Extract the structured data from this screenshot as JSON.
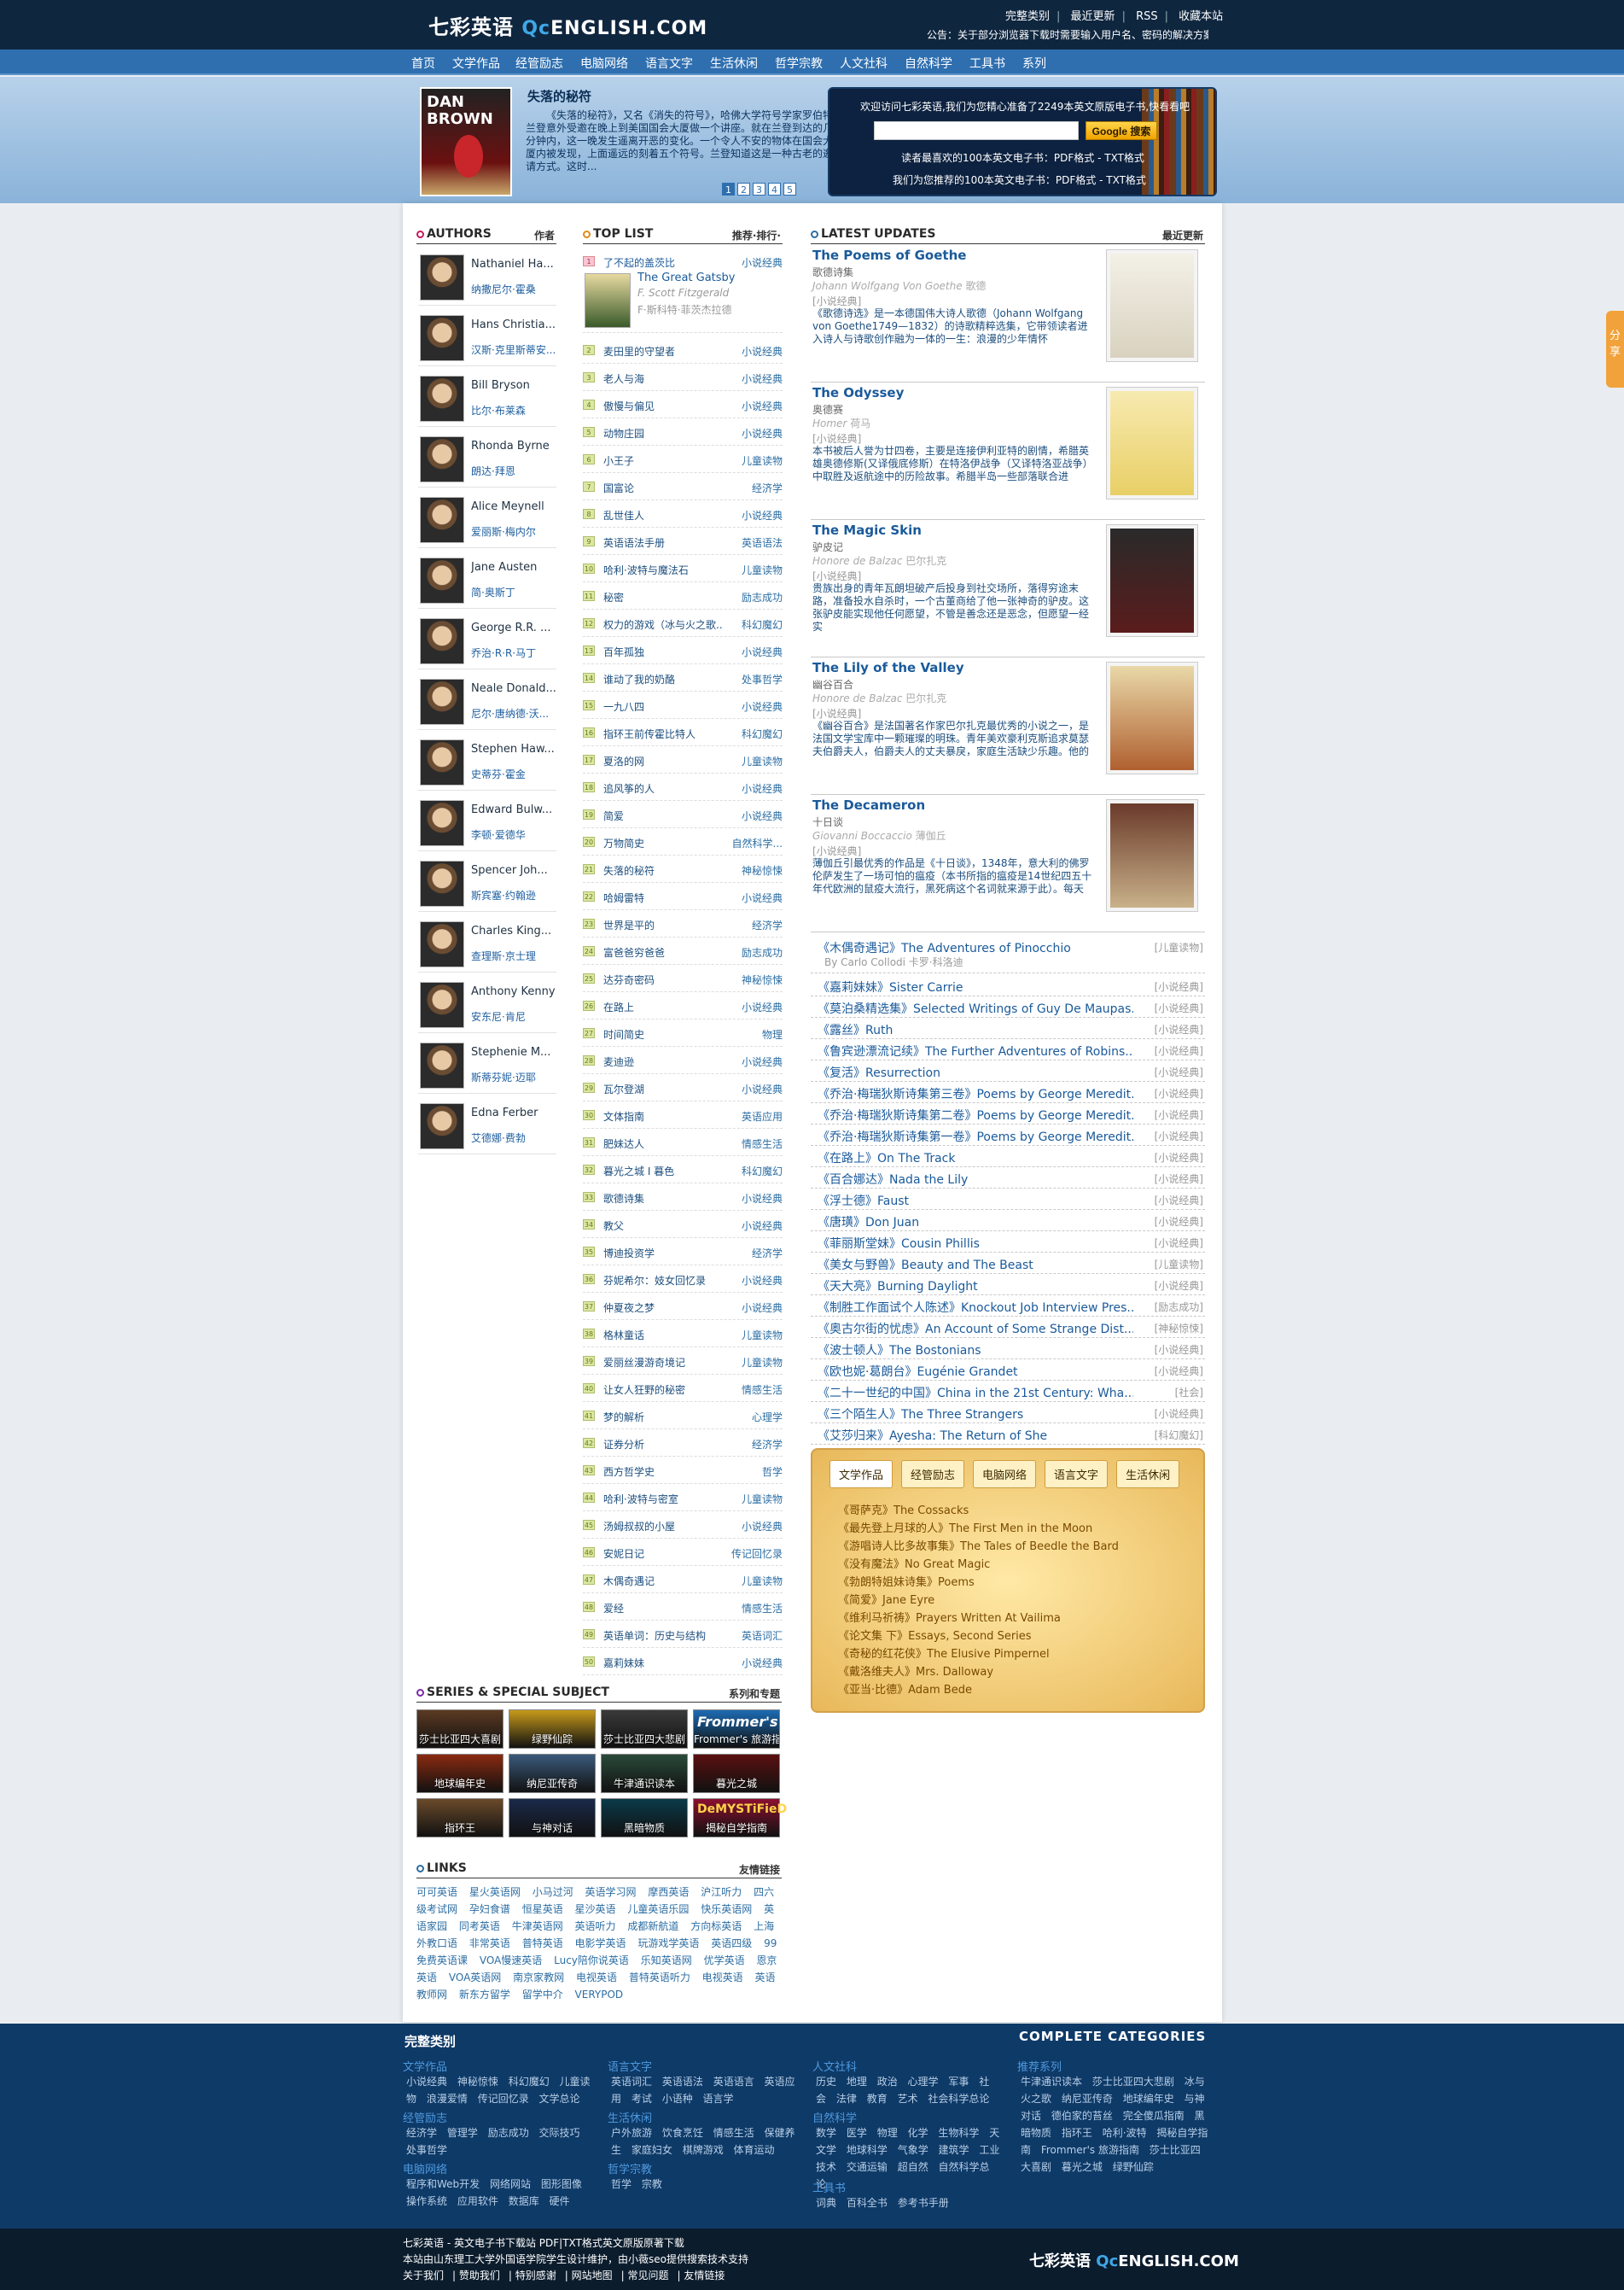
{
  "header": {
    "logo_cn": "七彩英语",
    "logo_qc": "Qc",
    "logo_en": "ENGLISH.COM",
    "top_links": [
      "完整类别",
      "最近更新",
      "RSS",
      "收藏本站"
    ],
    "notice": "公告：关于部分浏览器下载时需要输入用户名、密码的解决方案"
  },
  "nav": [
    "首页",
    "文学作品",
    "经管励志",
    "电脑网络",
    "语言文字",
    "生活休闲",
    "哲学宗教",
    "人文社科",
    "自然科学",
    "工具书",
    "系列"
  ],
  "banner": {
    "cover_text": "DAN BROWN",
    "title": "失落的秘符",
    "desc": "《失落的秘符》，又名《消失的符号》，哈佛大学符号学家罗伯特·兰登意外受邀在晚上到美国国会大厦做一个讲座。就在兰登到达的几分钟内，这一晚发生遥离开恶的变化。一个令人不安的物体在国会大厦内被发现，上面遥远的刻着五个符号。兰登知道这是一种古老的邀请方式。这时...",
    "pages": [
      "1",
      "2",
      "3",
      "4",
      "5"
    ],
    "welcome": "欢迎访问七彩英语,我们为您精心准备了2249本英文原版电子书,快看看吧",
    "search_placeholder": "",
    "search_button": "Google 搜索",
    "link1": "读者最喜欢的100本英文电子书：PDF格式 - TXT格式",
    "link2": "我们为您推荐的100本英文电子书：PDF格式 - TXT格式"
  },
  "authors": {
    "title": "AUTHORS",
    "right": "作者",
    "items": [
      {
        "en": "Nathaniel Ha...",
        "cn": "纳撒尼尔·霍桑"
      },
      {
        "en": "Hans Christia...",
        "cn": "汉斯·克里斯蒂安..."
      },
      {
        "en": "Bill Bryson",
        "cn": "比尔·布莱森"
      },
      {
        "en": "Rhonda Byrne",
        "cn": "朗达·拜恩"
      },
      {
        "en": "Alice Meynell",
        "cn": "爱丽斯·梅内尔"
      },
      {
        "en": "Jane Austen",
        "cn": "简·奥斯丁"
      },
      {
        "en": "George R.R. ...",
        "cn": "乔治·R·R·马丁"
      },
      {
        "en": "Neale Donald...",
        "cn": "尼尔·唐纳德·沃..."
      },
      {
        "en": "Stephen Haw...",
        "cn": "史蒂芬·霍金"
      },
      {
        "en": "Edward Bulw...",
        "cn": "李顿·爱德华"
      },
      {
        "en": "Spencer Joh...",
        "cn": "斯宾塞·约翰逊"
      },
      {
        "en": "Charles King...",
        "cn": "查理斯·京士理"
      },
      {
        "en": "Anthony Kenny",
        "cn": "安东尼·肯尼"
      },
      {
        "en": "Stephenie M...",
        "cn": "斯蒂芬妮·迈耶"
      },
      {
        "en": "Edna Ferber",
        "cn": "艾德娜·费勃"
      }
    ]
  },
  "toplist": {
    "title": "TOP LIST",
    "right": "推荐·排行·",
    "first": {
      "name": "了不起的盖茨比",
      "cat": "小说经典",
      "en": "The Great Gatsby",
      "author": "F. Scott Fitzgerald",
      "author_cn": "F·斯科特·菲茨杰拉德"
    },
    "items": [
      {
        "n": "2",
        "name": "麦田里的守望者",
        "cat": "小说经典"
      },
      {
        "n": "3",
        "name": "老人与海",
        "cat": "小说经典"
      },
      {
        "n": "4",
        "name": "傲慢与偏见",
        "cat": "小说经典"
      },
      {
        "n": "5",
        "name": "动物庄园",
        "cat": "小说经典"
      },
      {
        "n": "6",
        "name": "小王子",
        "cat": "儿童读物"
      },
      {
        "n": "7",
        "name": "国富论",
        "cat": "经济学"
      },
      {
        "n": "8",
        "name": "乱世佳人",
        "cat": "小说经典"
      },
      {
        "n": "9",
        "name": "英语语法手册",
        "cat": "英语语法"
      },
      {
        "n": "10",
        "name": "哈利·波特与魔法石",
        "cat": "儿童读物"
      },
      {
        "n": "11",
        "name": "秘密",
        "cat": "励志成功"
      },
      {
        "n": "12",
        "name": "权力的游戏（冰与火之歌...",
        "cat": "科幻魔幻"
      },
      {
        "n": "13",
        "name": "百年孤独",
        "cat": "小说经典"
      },
      {
        "n": "14",
        "name": "谁动了我的奶酪",
        "cat": "处事哲学"
      },
      {
        "n": "15",
        "name": "一九八四",
        "cat": "小说经典"
      },
      {
        "n": "16",
        "name": "指环王前传霍比特人",
        "cat": "科幻魔幻"
      },
      {
        "n": "17",
        "name": "夏洛的网",
        "cat": "儿童读物"
      },
      {
        "n": "18",
        "name": "追风筝的人",
        "cat": "小说经典"
      },
      {
        "n": "19",
        "name": "简爱",
        "cat": "小说经典"
      },
      {
        "n": "20",
        "name": "万物简史",
        "cat": "自然科学..."
      },
      {
        "n": "21",
        "name": "失落的秘符",
        "cat": "神秘惊悚"
      },
      {
        "n": "22",
        "name": "哈姆雷特",
        "cat": "小说经典"
      },
      {
        "n": "23",
        "name": "世界是平的",
        "cat": "经济学"
      },
      {
        "n": "24",
        "name": "富爸爸穷爸爸",
        "cat": "励志成功"
      },
      {
        "n": "25",
        "name": "达芬奇密码",
        "cat": "神秘惊悚"
      },
      {
        "n": "26",
        "name": "在路上",
        "cat": "小说经典"
      },
      {
        "n": "27",
        "name": "时间简史",
        "cat": "物理"
      },
      {
        "n": "28",
        "name": "麦迪逊",
        "cat": "小说经典"
      },
      {
        "n": "29",
        "name": "瓦尔登湖",
        "cat": "小说经典"
      },
      {
        "n": "30",
        "name": "文体指南",
        "cat": "英语应用"
      },
      {
        "n": "31",
        "name": "肥妹达人",
        "cat": "情感生活"
      },
      {
        "n": "32",
        "name": "暮光之城 I 暮色",
        "cat": "科幻魔幻"
      },
      {
        "n": "33",
        "name": "歌德诗集",
        "cat": "小说经典"
      },
      {
        "n": "34",
        "name": "教父",
        "cat": "小说经典"
      },
      {
        "n": "35",
        "name": "博迪投资学",
        "cat": "经济学"
      },
      {
        "n": "36",
        "name": "芬妮希尔：妓女回忆录",
        "cat": "小说经典"
      },
      {
        "n": "37",
        "name": "仲夏夜之梦",
        "cat": "小说经典"
      },
      {
        "n": "38",
        "name": "格林童话",
        "cat": "儿童读物"
      },
      {
        "n": "39",
        "name": "爱丽丝漫游奇境记",
        "cat": "儿童读物"
      },
      {
        "n": "40",
        "name": "让女人狂野的秘密",
        "cat": "情感生活"
      },
      {
        "n": "41",
        "name": "梦的解析",
        "cat": "心理学"
      },
      {
        "n": "42",
        "name": "证券分析",
        "cat": "经济学"
      },
      {
        "n": "43",
        "name": "西方哲学史",
        "cat": "哲学"
      },
      {
        "n": "44",
        "name": "哈利·波特与密室",
        "cat": "儿童读物"
      },
      {
        "n": "45",
        "name": "汤姆叔叔的小屋",
        "cat": "小说经典"
      },
      {
        "n": "46",
        "name": "安妮日记",
        "cat": "传记回忆录"
      },
      {
        "n": "47",
        "name": "木偶奇遇记",
        "cat": "儿童读物"
      },
      {
        "n": "48",
        "name": "爱经",
        "cat": "情感生活"
      },
      {
        "n": "49",
        "name": "英语单词：历史与结构",
        "cat": "英语词汇"
      },
      {
        "n": "50",
        "name": "嘉莉妹妹",
        "cat": "小说经典"
      }
    ]
  },
  "latest": {
    "title": "LATEST UPDATES",
    "right": "最近更新",
    "featured": [
      {
        "title": "The Poems of Goethe",
        "cn": "歌德诗集",
        "author": "Johann Wolfgang Von Goethe",
        "author_cn": "歌德",
        "cat": "[小说经典]",
        "desc": "《歌德诗选》是一本德国伟大诗人歌德（Johann Wolfgang von Goethe1749—1832）的诗歌精粹选集，它带领读者进入诗人与诗歌创作融为一体的一生：浪漫的少年情怀"
      },
      {
        "title": "The Odyssey",
        "cn": "奥德赛",
        "author": "Homer",
        "author_cn": "荷马",
        "cat": "[小说经典]",
        "desc": "本书被后人誉为廿四卷，主要是连接伊利亚特的剧情，希腊英雄奥德修斯(又译俄底修斯）在特洛伊战争（又译特洛亚战争）中取胜及返航途中的历险故事。希腊半岛一些部落联合进"
      },
      {
        "title": "The Magic Skin",
        "cn": "驴皮记",
        "author": "Honore de Balzac",
        "author_cn": "巴尔扎克",
        "cat": "[小说经典]",
        "desc": "贵族出身的青年瓦朗坦破产后投身到社交场所，落得穷途末路，准备投水自杀时，一个古董商给了他一张神奇的驴皮。这张驴皮能实现他任何愿望，不管是善念还是恶念，但愿望一经实"
      },
      {
        "title": "The Lily of the Valley",
        "cn": "幽谷百合",
        "author": "Honore de Balzac",
        "author_cn": "巴尔扎克",
        "cat": "[小说经典]",
        "desc": "《幽谷百合》是法国著名作家巴尔扎克最优秀的小说之一，是法国文学宝库中一颗璀璨的明珠。青年美欢豪利克斯追求莫瑟夫伯爵夫人，伯爵夫人的丈夫暴戾，家庭生活缺少乐趣。他的"
      },
      {
        "title": "The Decameron",
        "cn": "十日谈",
        "author": "Giovanni Boccaccio",
        "author_cn": "薄伽丘",
        "cat": "[小说经典]",
        "desc": "薄伽丘引最优秀的作品是《十日谈》，1348年，意大利的佛罗伦萨发生了一场可怕的瘟疫（本书所指的瘟疫是14世纪四五十年代欧洲的鼠疫大流行，黑死病这个名词就来源于此）。每天"
      }
    ],
    "pinocchio": {
      "text": "《木偶奇遇记》The Adventures of Pinocchio",
      "cat": "[儿童读物]",
      "author": "By Carlo Collodi 卡罗·科洛迪"
    },
    "list": [
      {
        "text": "《嘉莉妹妹》Sister Carrie",
        "cat": "[小说经典]"
      },
      {
        "text": "《莫泊桑精选集》Selected Writings of Guy De Maupas...",
        "cat": "[小说经典]"
      },
      {
        "text": "《露丝》Ruth",
        "cat": "[小说经典]"
      },
      {
        "text": "《鲁宾逊漂流记续》The Further Adventures of Robins...",
        "cat": "[小说经典]"
      },
      {
        "text": "《复活》Resurrection",
        "cat": "[小说经典]"
      },
      {
        "text": "《乔治·梅瑞狄斯诗集第三卷》Poems by George Meredit...",
        "cat": "[小说经典]"
      },
      {
        "text": "《乔治·梅瑞狄斯诗集第二卷》Poems by George Meredit...",
        "cat": "[小说经典]"
      },
      {
        "text": "《乔治·梅瑞狄斯诗集第一卷》Poems by George Meredit...",
        "cat": "[小说经典]"
      },
      {
        "text": "《在路上》On The Track",
        "cat": "[小说经典]"
      },
      {
        "text": "《百合娜达》Nada the Lily",
        "cat": "[小说经典]"
      },
      {
        "text": "《浮士德》Faust",
        "cat": "[小说经典]"
      },
      {
        "text": "《唐璜》Don Juan",
        "cat": "[小说经典]"
      },
      {
        "text": "《菲丽斯堂妹》Cousin Phillis",
        "cat": "[小说经典]"
      },
      {
        "text": "《美女与野兽》Beauty and The Beast",
        "cat": "[儿童读物]"
      },
      {
        "text": "《天大亮》Burning Daylight",
        "cat": "[小说经典]"
      },
      {
        "text": "《制胜工作面试个人陈述》Knockout Job Interview Pres...",
        "cat": "[励志成功]"
      },
      {
        "text": "《奥古尔街的忧虑》An Account of Some Strange Dist...",
        "cat": "[神秘惊悚]"
      },
      {
        "text": "《波士顿人》The Bostonians",
        "cat": "[小说经典]"
      },
      {
        "text": "《欧也妮·葛朗台》Eugénie Grandet",
        "cat": "[小说经典]"
      },
      {
        "text": "《二十一世纪的中国》China in the 21st Century: Wha...",
        "cat": "[社会]"
      },
      {
        "text": "《三个陌生人》The Three Strangers",
        "cat": "[小说经典]"
      },
      {
        "text": "《艾莎归来》Ayesha: The Return of She",
        "cat": "[科幻魔幻]"
      }
    ]
  },
  "yellowbox": {
    "tabs": [
      "文学作品",
      "经管励志",
      "电脑网络",
      "语言文字",
      "生活休闲"
    ],
    "items": [
      "《哥萨克》The Cossacks",
      "《最先登上月球的人》The First Men in the Moon",
      "《游唱诗人比多故事集》The Tales of Beedle the Bard",
      "《没有魔法》No Great Magic",
      "《勃朗特姐妹诗集》Poems",
      "《简爱》Jane Eyre",
      "《维利马祈祷》Prayers Written At Vailima",
      "《论文集 下》Essays, Second Series",
      "《奇秘的红花侠》The Elusive Pimpernel",
      "《戴洛维夫人》Mrs. Dalloway",
      "《亚当·比德》Adam Bede"
    ]
  },
  "series": {
    "title": "SERIES & SPECIAL SUBJECT",
    "right": "系列和专题",
    "tiles": [
      {
        "label": "莎士比亚四大喜剧",
        "color": "#5b3a22"
      },
      {
        "label": "绿野仙踪",
        "color": "#c79a1a"
      },
      {
        "label": "莎士比亚四大悲剧",
        "color": "#3a3a3a"
      },
      {
        "label": "Frommer's 旅游指",
        "color": "#1c6bb3"
      },
      {
        "label": "地球编年史",
        "color": "#8a2a10"
      },
      {
        "label": "纳尼亚传奇",
        "color": "#3a5a7a"
      },
      {
        "label": "牛津通识读本",
        "color": "#2a4a3a"
      },
      {
        "label": "暮光之城",
        "color": "#5a1010"
      },
      {
        "label": "指环王",
        "color": "#6a4a2a"
      },
      {
        "label": "与神对话",
        "color": "#1a2a4a"
      },
      {
        "label": "黑暗物质",
        "color": "#0a3a4a"
      },
      {
        "label": "揭秘自学指南",
        "color": "#8a1030"
      }
    ],
    "tile_texts": [
      "Frommer's",
      "DeMYSTiFieD"
    ]
  },
  "links": {
    "title": "LINKS",
    "right": "友情链接",
    "items": [
      "可可英语",
      "星火英语网",
      "小马过河",
      "英语学习网",
      "摩西英语",
      "沪江听力",
      "四六级考试网",
      "孕妇食谱",
      "恒星英语",
      "星沙英语",
      "儿童英语乐园",
      "快乐英语网",
      "英语家园",
      "同考英语",
      "牛津英语网",
      "英语听力",
      "成都新航道",
      "方向标英语",
      "上海外教口语",
      "非常英语",
      "普特英语",
      "电影学英语",
      "玩游戏学英语",
      "英语四级",
      "99免费英语课",
      "VOA慢速英语",
      "Lucy陪你说英语",
      "乐知英语网",
      "优学英语",
      "恩京英语",
      "VOA英语网",
      "南京家教网",
      "电视英语",
      "普特英语听力",
      "电视英语",
      "英语教师网",
      "新东方留学",
      "留学中介",
      "VERYPOD"
    ]
  },
  "footer": {
    "cap_cn": "完整类别",
    "cap_en": "COMPLETE CATEGORIES",
    "cols": [
      {
        "head": "文学作品",
        "items": [
          "小说经典",
          "神秘惊悚",
          "科幻魔幻",
          "儿童读物",
          "浪漫爱情",
          "传记回忆录",
          "文学总论"
        ]
      },
      {
        "head": "经管励志",
        "items": [
          "经济学",
          "管理学",
          "励志成功",
          "交际技巧",
          "处事哲学"
        ]
      },
      {
        "head": "电脑网络",
        "items": [
          "程序和Web开发",
          "网络网站",
          "图形图像",
          "操作系统",
          "应用软件",
          "数据库",
          "硬件"
        ]
      },
      {
        "head": "语言文字",
        "items": [
          "英语词汇",
          "英语语法",
          "英语语言",
          "英语应用",
          "考试",
          "小语种",
          "语言学"
        ]
      },
      {
        "head": "生活休闲",
        "items": [
          "户外旅游",
          "饮食烹饪",
          "情感生活",
          "保健养生",
          "家庭妇女",
          "棋牌游戏",
          "体育运动"
        ]
      },
      {
        "head": "哲学宗教",
        "items": [
          "哲学",
          "宗教"
        ]
      },
      {
        "head": "人文社科",
        "items": [
          "历史",
          "地理",
          "政治",
          "心理学",
          "军事",
          "社会",
          "法律",
          "教育",
          "艺术",
          "社会科学总论"
        ]
      },
      {
        "head": "自然科学",
        "items": [
          "数学",
          "医学",
          "物理",
          "化学",
          "生物科学",
          "天文学",
          "地球科学",
          "气象学",
          "建筑学",
          "工业技术",
          "交通运输",
          "超自然",
          "自然科学总论"
        ]
      },
      {
        "head": "工具书",
        "items": [
          "词典",
          "百科全书",
          "参考书手册"
        ]
      },
      {
        "head": "推荐系列",
        "items": [
          "牛津通识读本",
          "莎士比亚四大悲剧",
          "冰与火之歌",
          "纳尼亚传奇",
          "地球编年史",
          "与神对话",
          "德伯家的苔丝",
          "完全傻瓜指南",
          "黑暗物质",
          "指环王",
          "哈利·波特",
          "揭秘自学指南",
          "Frommer's 旅游指南",
          "莎士比亚四大喜剧",
          "暮光之城",
          "绿野仙踪"
        ]
      }
    ]
  },
  "bottom": {
    "line1": "七彩英语 - 英文电子书下载站 PDF|TXT格式英文原版原著下载",
    "line2": "本站由山东理工大学外国语学院学生设计维护，由小薇seo提供搜索技术支持",
    "links": [
      "关于我们",
      "赞助我们",
      "特别感谢",
      "网站地图",
      "常见问题",
      "友情链接"
    ],
    "logo_cn": "七彩英语",
    "logo_qc": "Qc",
    "logo_en": "ENGLISH.COM"
  },
  "share": "分享"
}
